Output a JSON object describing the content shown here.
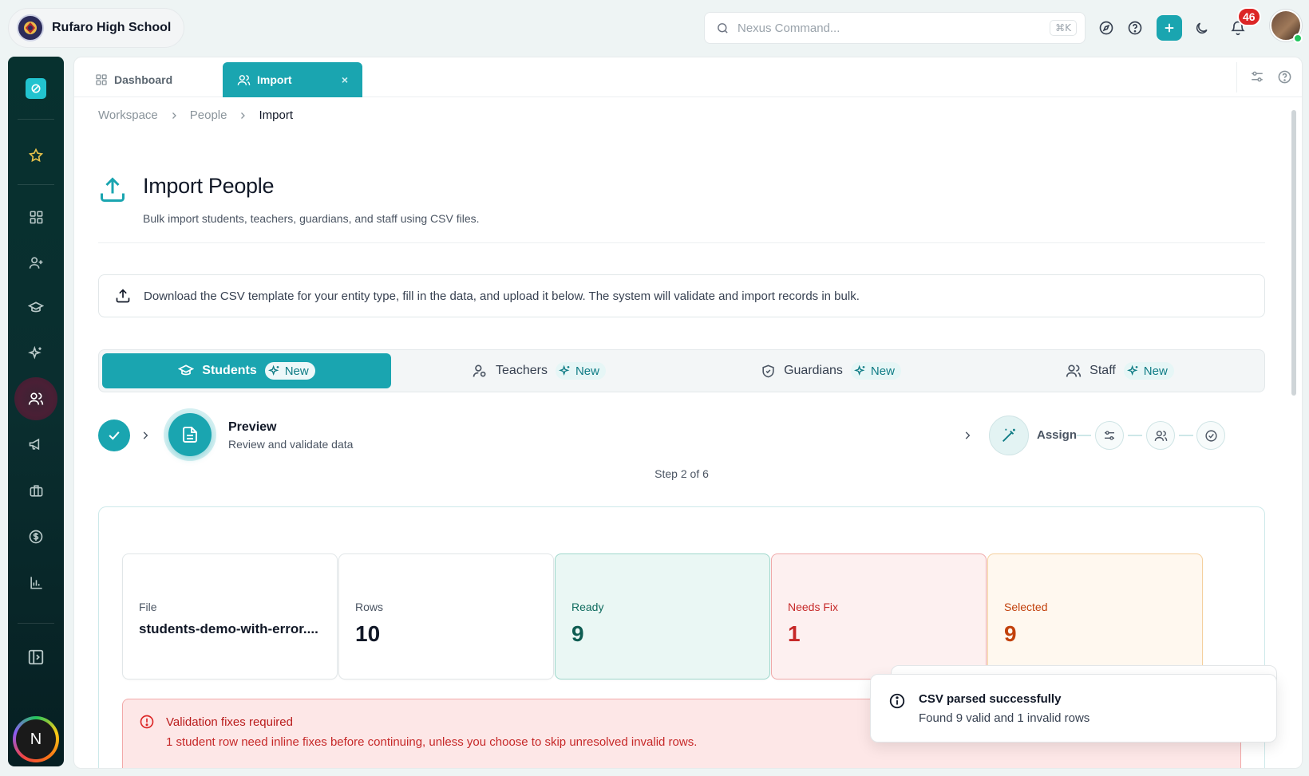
{
  "app": {
    "school_name": "Rufaro High School",
    "search_placeholder": "Nexus Command...",
    "search_shortcut": "⌘K",
    "notification_count": "46",
    "user_initial": "N"
  },
  "colors": {
    "accent": "#1aa5b0",
    "sidebar": "#07312f",
    "danger": "#dc2626",
    "ready": "#0f5d52",
    "selected": "#c2410c"
  },
  "tabs": [
    {
      "label": "Dashboard",
      "icon": "grid-icon"
    },
    {
      "label": "Import",
      "icon": "users-icon",
      "close": "×"
    }
  ],
  "breadcrumb": [
    "Workspace",
    "People",
    "Import"
  ],
  "page": {
    "title": "Import People",
    "subtitle": "Bulk import students, teachers, guardians, and staff using CSV files.",
    "info": "Download the CSV template for your entity type, fill in the data, and upload it below. The system will validate and import records in bulk."
  },
  "entities": [
    {
      "label": "Students",
      "badge": "New",
      "icon": "graduation-cap-icon",
      "active": true
    },
    {
      "label": "Teachers",
      "badge": "New",
      "icon": "user-icon"
    },
    {
      "label": "Guardians",
      "badge": "New",
      "icon": "shield-icon"
    },
    {
      "label": "Staff",
      "badge": "New",
      "icon": "users-icon"
    }
  ],
  "stepper": {
    "current_name": "Preview",
    "current_desc": "Review and validate data",
    "next_label": "Assign",
    "step_text": "Step 2 of 6"
  },
  "stats": {
    "file_label": "File",
    "file_value": "students-demo-with-error....",
    "rows_label": "Rows",
    "rows_value": "10",
    "ready_label": "Ready",
    "ready_value": "9",
    "fix_label": "Needs Fix",
    "fix_value": "1",
    "selected_label": "Selected",
    "selected_value": "9"
  },
  "alert": {
    "title": "Validation fixes required",
    "text": "1 student row need inline fixes before continuing, unless you choose to skip unresolved invalid rows."
  },
  "toast": {
    "title": "CSV parsed successfully",
    "text": "Found 9 valid and 1 invalid rows"
  }
}
